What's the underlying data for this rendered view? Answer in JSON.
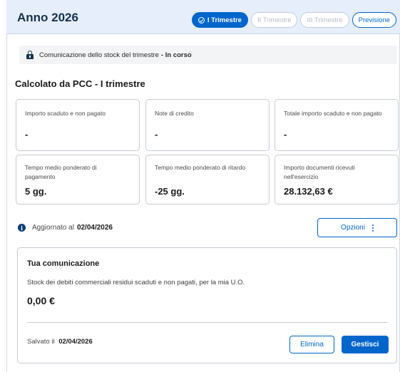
{
  "header": {
    "year": "Anno 2026",
    "tabs": [
      {
        "label": "I Trimestre",
        "state": "active"
      },
      {
        "label": "II Trimestre",
        "state": "disabled"
      },
      {
        "label": "III Trimestre",
        "state": "disabled"
      },
      {
        "label": "Previsione",
        "state": "outline"
      }
    ]
  },
  "status": {
    "icon": "lock-icon",
    "text": "Comunicazione dello stock del trimestre",
    "state": "- In corso"
  },
  "section": {
    "title": "Calcolato da PCC - I trimestre"
  },
  "cards": [
    {
      "label": "Importo scaduto e non pagato",
      "value": "-"
    },
    {
      "label": "Note di credito",
      "value": "-"
    },
    {
      "label": "Totale importo scaduto e non pagato",
      "value": "-"
    },
    {
      "label": "Tempo medio ponderato di pagamento",
      "value": "5 gg."
    },
    {
      "label": "Tempo medio ponderato di ritardo",
      "value": "-25 gg."
    },
    {
      "label": "Importo documenti ricevuti nell'esercizio",
      "value": "28.132,63 €"
    }
  ],
  "updated": {
    "icon": "info-icon",
    "icon_glyph": "i",
    "label": "Aggiornato al",
    "date": "02/04/2026"
  },
  "options_button": {
    "label": "Opzioni"
  },
  "communication": {
    "title": "Tua comunicazione",
    "description": "Stock dei debiti commerciali residui scaduti e non pagati, per la mia U.O.",
    "amount": "0,00 €",
    "saved_label": "Salvato il",
    "saved_date": "02/04/2026",
    "delete_label": "Elimina",
    "manage_label": "Gestisci"
  },
  "colors": {
    "accent": "#0066cc",
    "header_bg": "#e5eefa",
    "title_text": "#17324d"
  }
}
